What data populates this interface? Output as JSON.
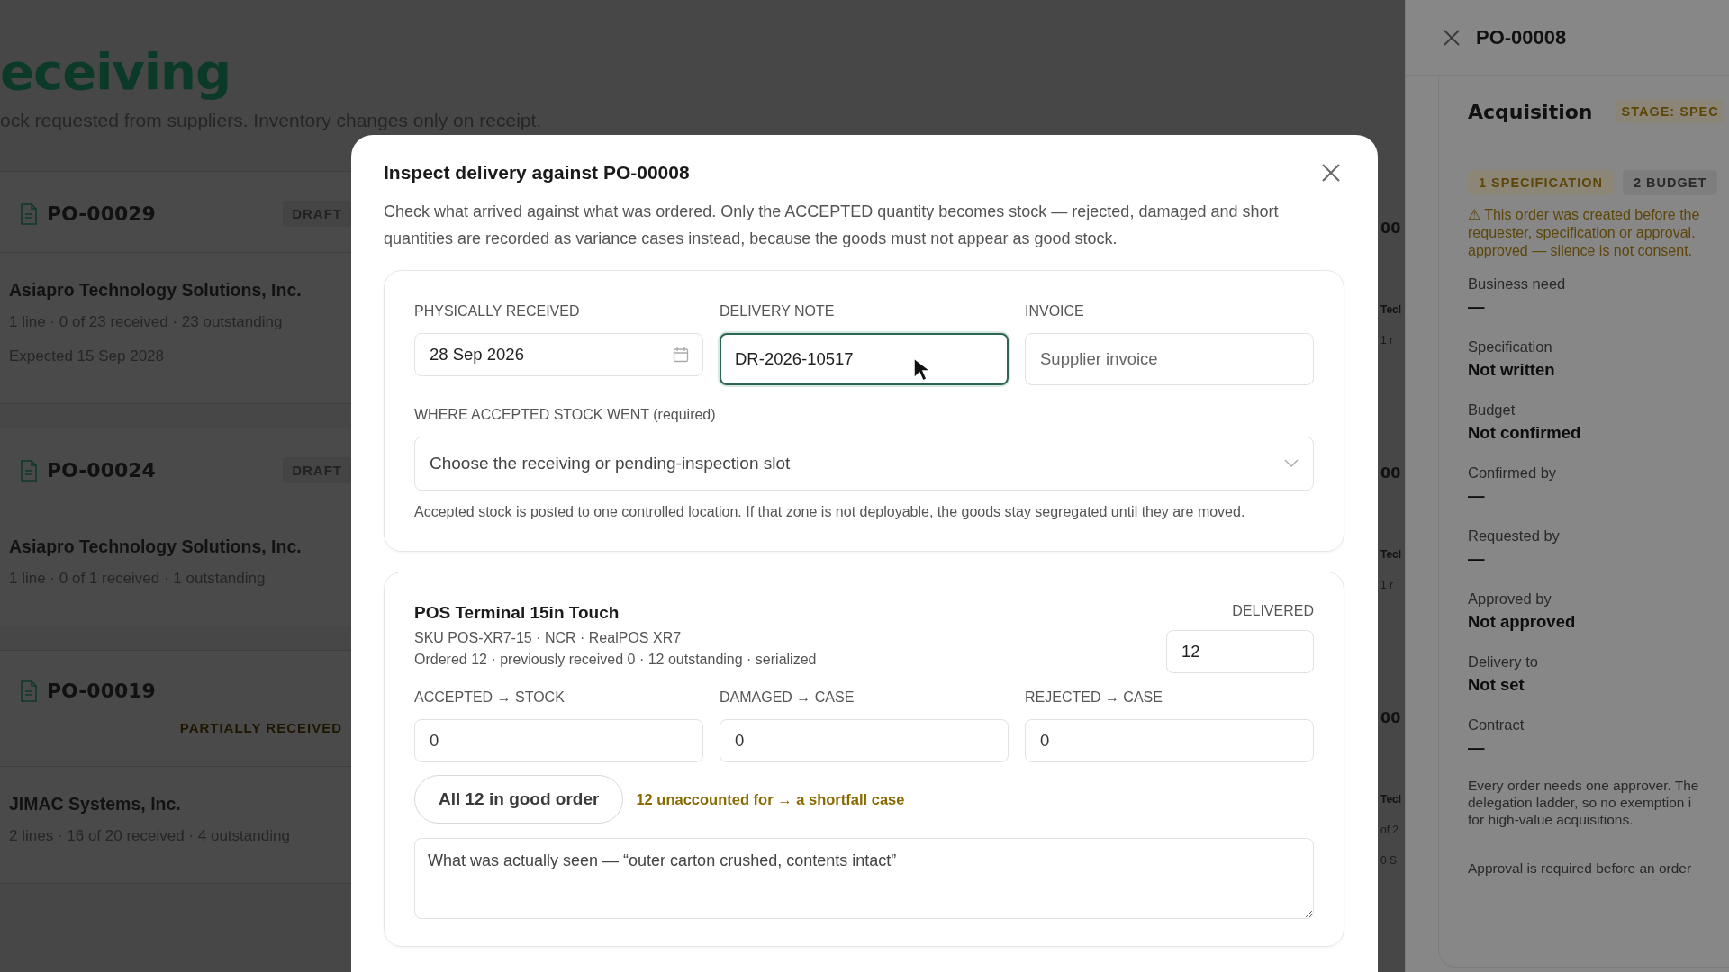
{
  "page": {
    "title": "eceiving",
    "subtitle": "ock requested from suppliers. Inventory changes only on receipt."
  },
  "orders": [
    {
      "number": "PO-00029",
      "badge": {
        "label": "DRAFT",
        "kind": "draft"
      },
      "supplier": "Asiapro Technology Solutions, Inc.",
      "details": [
        "1 line · 0 of 23 received · 23 outstanding",
        "Expected 15 Sep 2028"
      ]
    },
    {
      "number": "PO-00024",
      "badge": {
        "label": "DRAFT",
        "kind": "draft"
      },
      "supplier": "Asiapro Technology Solutions, Inc.",
      "details": [
        "1 line · 0 of 1 received · 1 outstanding"
      ]
    },
    {
      "number": "PO-00019",
      "badge": {
        "label": "PARTIALLY RECEIVED",
        "kind": "partial"
      },
      "supplier": "JIMAC Systems, Inc.",
      "details": [
        "2 lines · 16 of 20 received · 4 outstanding"
      ]
    }
  ],
  "orders_column_2": [
    {
      "number": "00",
      "supplier": "Tecl",
      "details": [
        "1 r"
      ]
    },
    {
      "number": "00",
      "supplier": "Tecl",
      "details": [
        "1 r"
      ]
    },
    {
      "number": "00",
      "supplier": "Tecl",
      "details": [
        "of 2",
        "0 S"
      ]
    }
  ],
  "dialog": {
    "title": "Inspect delivery against PO-00008",
    "description": "Check what arrived against what was ordered. Only the ACCEPTED quantity becomes stock — rejected, damaged and short quantities are recorded as variance cases instead, because the goods must not appear as good stock.",
    "receipt": {
      "fields": [
        {
          "label": "PHYSICALLY RECEIVED",
          "value": "28 Sep 2026",
          "kind": "date",
          "focused": false
        },
        {
          "label": "DELIVERY NOTE",
          "value": "DR-2026-10517",
          "kind": "text",
          "focused": true
        },
        {
          "label": "INVOICE",
          "placeholder": "Supplier invoice",
          "kind": "text",
          "focused": false
        }
      ],
      "location": {
        "label": "WHERE ACCEPTED STOCK WENT (required)",
        "placeholder": "Choose the receiving or pending-inspection slot",
        "hint": "Accepted stock is posted to one controlled location. If that zone is not deployable, the goods stay segregated until they are moved."
      }
    },
    "line": {
      "name": "POS Terminal 15in Touch",
      "sku": "SKU POS-XR7-15 · NCR · RealPOS XR7",
      "status": "Ordered 12 · previously received 0 · 12 outstanding · serialized",
      "delivered": {
        "label": "DELIVERED",
        "value": "12"
      },
      "quantities": [
        {
          "label": "ACCEPTED → STOCK",
          "value": "0"
        },
        {
          "label": "DAMAGED → CASE",
          "value": "0"
        },
        {
          "label": "REJECTED → CASE",
          "value": "0"
        }
      ],
      "fill_button": "All 12 in good order",
      "warning": "12 unaccounted for → a shortfall case",
      "note": {
        "placeholder": "What was actually seen — “outer carton crushed, contents intact”"
      }
    }
  },
  "drawer": {
    "title": "PO-00008",
    "section": {
      "title": "Acquisition",
      "stage": "STAGE: SPEC",
      "steps": [
        {
          "label": "1 SPECIFICATION",
          "selected": true
        },
        {
          "label": "2 BUDGET",
          "selected": false
        }
      ],
      "warning": [
        "⚠ This order was created before the",
        "requester, specification or approval.",
        "approved — silence is not consent."
      ],
      "fields": [
        {
          "label": "Business need",
          "value": "—"
        },
        {
          "label": "Specification",
          "value": "Not written"
        },
        {
          "label": "Budget",
          "value": "Not confirmed"
        },
        {
          "label": "Confirmed by",
          "value": "—"
        },
        {
          "label": "Requested by",
          "value": "—"
        },
        {
          "label": "Approved by",
          "value": "Not approved"
        },
        {
          "label": "Delivery to",
          "value": "Not set"
        },
        {
          "label": "Contract",
          "value": "—"
        }
      ],
      "notes": [
        "Every order needs one approver. The",
        "delegation ladder, so no exemption i",
        "for high-value acquisitions."
      ],
      "footer": "Approval is required before an order"
    }
  }
}
